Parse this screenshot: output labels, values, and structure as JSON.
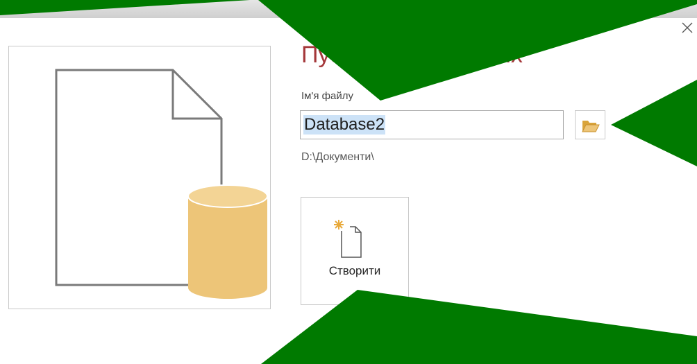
{
  "dialog": {
    "title": "Пустая база данных",
    "file_name_label": "Ім'я файлу",
    "file_name_value": "Database2",
    "path": "D:\\Документи\\",
    "create_label": "Створити"
  },
  "icons": {
    "close": "close-icon",
    "browse": "folder-open-icon",
    "create": "new-document-icon",
    "preview": "database-file-icon"
  },
  "colors": {
    "title": "#a4373a",
    "selection": "#cce2f7",
    "database_cylinder": "#edc578",
    "overlay": "#007a00"
  }
}
